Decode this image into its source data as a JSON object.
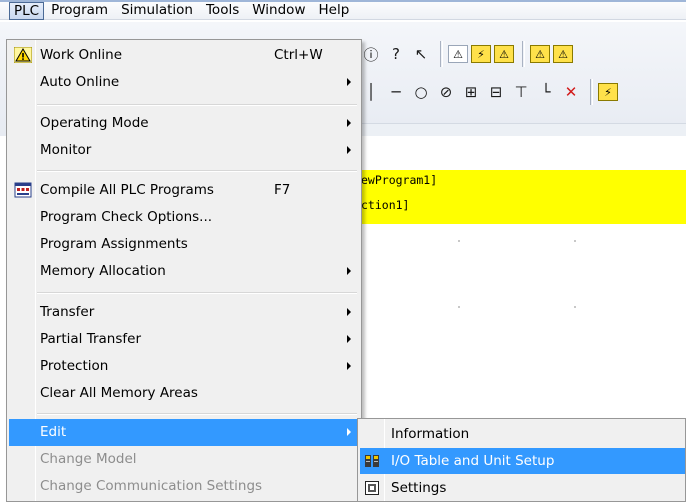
{
  "menubar": {
    "items": [
      {
        "label": "PLC",
        "active": true
      },
      {
        "label": "Program"
      },
      {
        "label": "Simulation"
      },
      {
        "label": "Tools"
      },
      {
        "label": "Window"
      },
      {
        "label": "Help"
      }
    ]
  },
  "workarea": {
    "line1": "ewProgram1]",
    "line2": "ction1]"
  },
  "plc_menu": {
    "work_online": {
      "label": "Work Online",
      "shortcut": "Ctrl+W"
    },
    "auto_online": {
      "label": "Auto Online"
    },
    "operating_mode": {
      "label": "Operating Mode"
    },
    "monitor": {
      "label": "Monitor"
    },
    "compile_all": {
      "label": "Compile All PLC Programs",
      "shortcut": "F7"
    },
    "program_check": {
      "label": "Program Check Options..."
    },
    "program_assign": {
      "label": "Program Assignments"
    },
    "memory_alloc": {
      "label": "Memory Allocation"
    },
    "transfer": {
      "label": "Transfer"
    },
    "partial_transfer": {
      "label": "Partial Transfer"
    },
    "protection": {
      "label": "Protection"
    },
    "clear_memory": {
      "label": "Clear All Memory Areas"
    },
    "edit": {
      "label": "Edit"
    },
    "change_model": {
      "label": "Change Model"
    },
    "change_comm": {
      "label": "Change Communication Settings"
    }
  },
  "edit_submenu": {
    "information": {
      "label": "Information"
    },
    "io_table": {
      "label": "I/O Table and Unit Setup"
    },
    "settings": {
      "label": "Settings"
    }
  },
  "colors": {
    "highlight": "#3399ff",
    "menu_bg": "#f0f0f0",
    "band": "#ffff00"
  },
  "icons": {
    "work_online": "warning-triangle-icon",
    "compile": "compile-icon",
    "io_table": "io-table-icon",
    "settings": "settings-icon"
  }
}
